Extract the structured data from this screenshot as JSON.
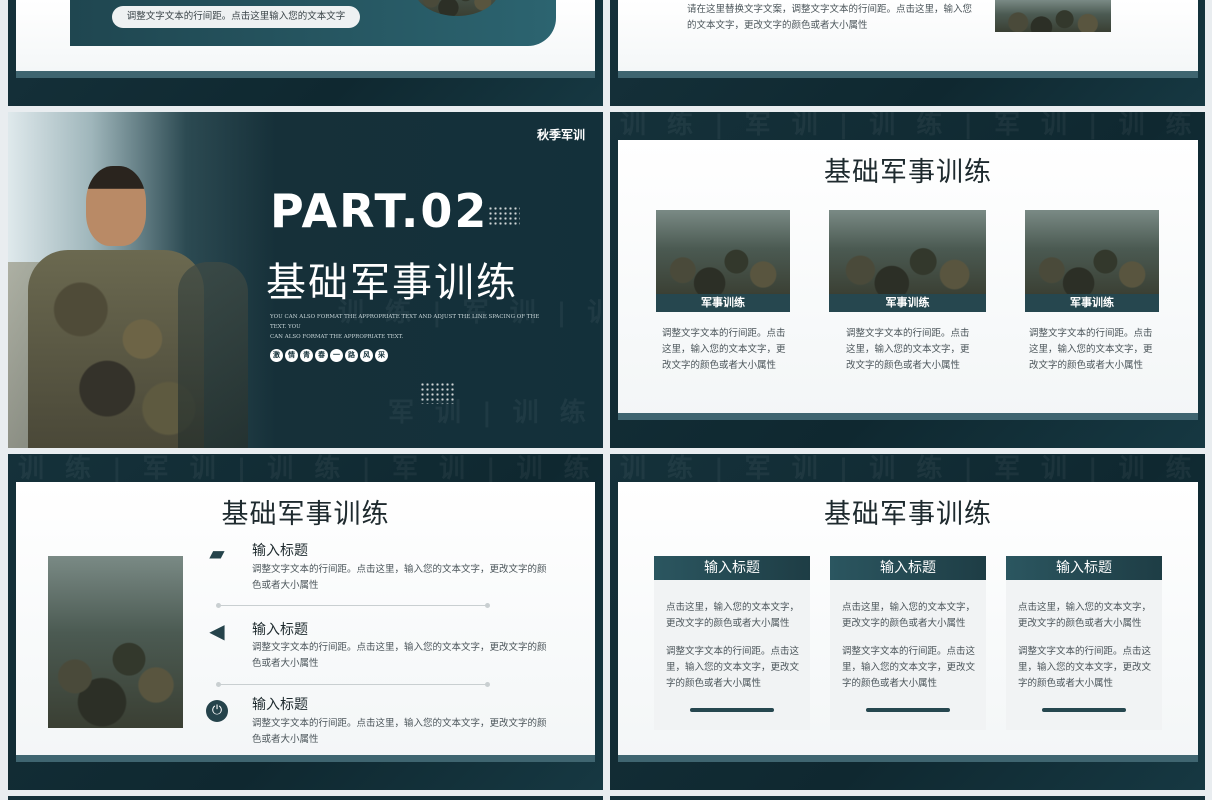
{
  "slide_top_left": {
    "pill_text": "调整文字文本的行间距。点击这里输入您的文本文字"
  },
  "slide_top_right": {
    "text_line1": "请在这里替换文字文案，调整文字文本的行间距。点击这里，输入您",
    "text_line2": "的文本文字，更改文字的颜色或者大小属性"
  },
  "cover": {
    "logo": "秋季军训",
    "part": "PART.02",
    "title": "基础军事训练",
    "subtitle_line1": "YOU CAN ALSO FORMAT THE APPROPRIATE TEXT AND ADJUST THE LINE SPACING OF THE TEXT. YOU",
    "subtitle_line2": "CAN ALSO FORMAT THE APPROPRIATE TEXT.",
    "tags": [
      "激",
      "情",
      "青",
      "春",
      "一",
      "路",
      "风",
      "采"
    ]
  },
  "slide_photos": {
    "title": "基础军事训练",
    "items": [
      {
        "caption": "军事训练",
        "text": "调整文字文本的行间距。点击这里，输入您的文本文字，更改文字的颜色或者大小属性"
      },
      {
        "caption": "军事训练",
        "text": "调整文字文本的行间距。点击这里，输入您的文本文字，更改文字的颜色或者大小属性"
      },
      {
        "caption": "军事训练",
        "text": "调整文字文本的行间距。点击这里，输入您的文本文字，更改文字的颜色或者大小属性"
      }
    ]
  },
  "slide_list": {
    "title": "基础军事训练",
    "items": [
      {
        "icon": "folder-icon",
        "title": "输入标题",
        "text": "调整文字文本的行间距。点击这里，输入您的文本文字，更改文字的颜色或者大小属性"
      },
      {
        "icon": "megaphone-icon",
        "title": "输入标题",
        "text": "调整文字文本的行间距。点击这里，输入您的文本文字，更改文字的颜色或者大小属性"
      },
      {
        "icon": "power-icon",
        "title": "输入标题",
        "text": "调整文字文本的行间距。点击这里，输入您的文本文字，更改文字的颜色或者大小属性"
      }
    ]
  },
  "slide_columns": {
    "title": "基础军事训练",
    "items": [
      {
        "header": "输入标题",
        "text1": "点击这里，输入您的文本文字，更改文字的颜色或者大小属性",
        "text2": "调整文字文本的行间距。点击这里，输入您的文本文字，更改文字的颜色或者大小属性"
      },
      {
        "header": "输入标题",
        "text1": "点击这里，输入您的文本文字，更改文字的颜色或者大小属性",
        "text2": "调整文字文本的行间距。点击这里，输入您的文本文字，更改文字的颜色或者大小属性"
      },
      {
        "header": "输入标题",
        "text1": "点击这里，输入您的文本文字，更改文字的颜色或者大小属性",
        "text2": "调整文字文本的行间距。点击这里，输入您的文本文字，更改文字的颜色或者大小属性"
      }
    ]
  },
  "colors": {
    "dark_teal": "#15313a",
    "accent": "#26474f",
    "text": "#1e2a2e"
  }
}
